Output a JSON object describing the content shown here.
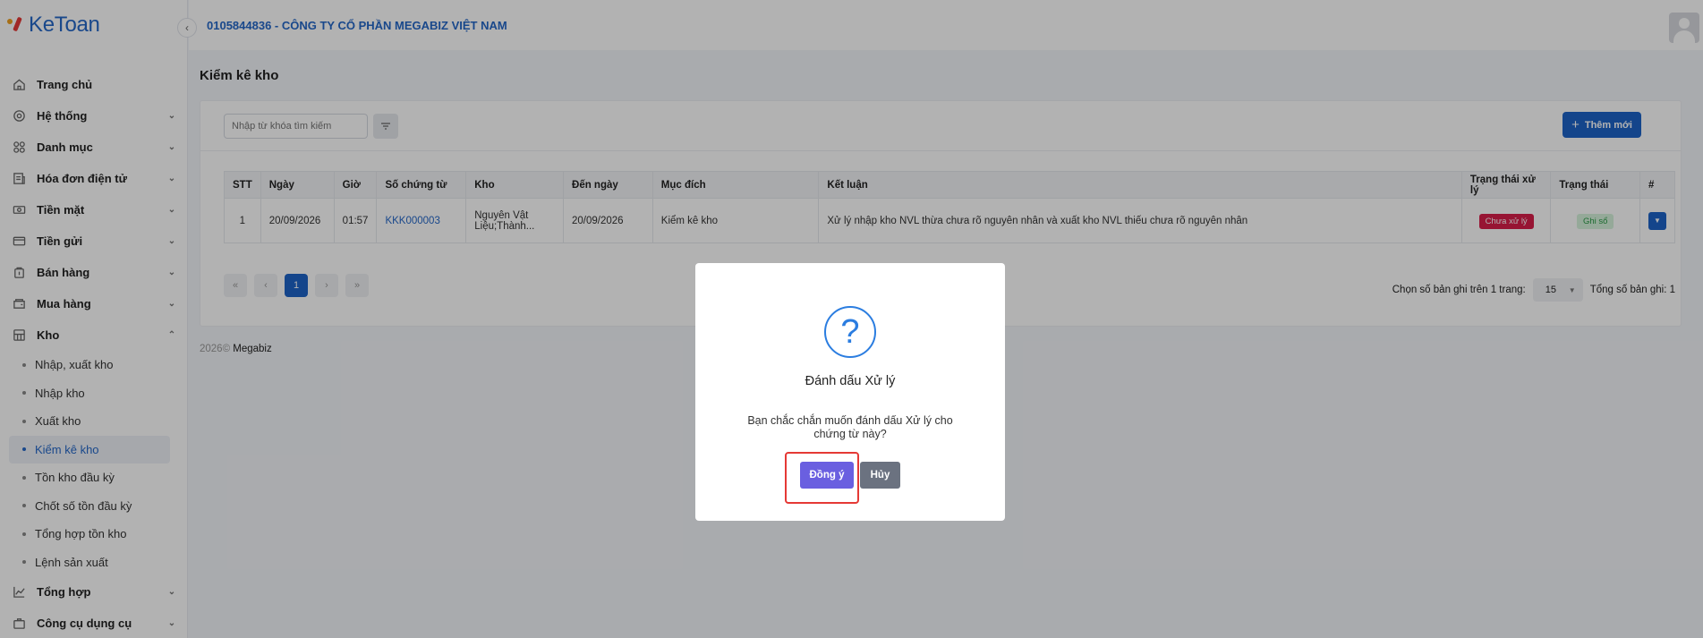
{
  "brand": {
    "logo_text": "KeToan"
  },
  "header": {
    "company": "0105844836 - CÔNG TY CỔ PHẦN MEGABIZ VIỆT NAM"
  },
  "sidebar": {
    "items": [
      {
        "label": "Trang chủ",
        "icon": "home-icon"
      },
      {
        "label": "Hệ thống",
        "icon": "settings-icon"
      },
      {
        "label": "Danh mục",
        "icon": "grid-icon"
      },
      {
        "label": "Hóa đơn điện tử",
        "icon": "invoice-icon"
      },
      {
        "label": "Tiền mặt",
        "icon": "cash-icon"
      },
      {
        "label": "Tiền gửi",
        "icon": "card-icon"
      },
      {
        "label": "Bán hàng",
        "icon": "sales-icon"
      },
      {
        "label": "Mua hàng",
        "icon": "purchase-icon"
      },
      {
        "label": "Kho",
        "icon": "warehouse-icon"
      }
    ],
    "kho_sub": [
      "Nhập, xuất kho",
      "Nhập kho",
      "Xuất kho",
      "Kiểm kê kho",
      "Tồn kho đầu kỳ",
      "Chốt số tồn đầu kỳ",
      "Tổng hợp tồn kho",
      "Lệnh sản xuất"
    ],
    "bottom_items": [
      {
        "label": "Tổng hợp",
        "icon": "chart-icon"
      },
      {
        "label": "Công cụ dụng cụ",
        "icon": "tools-icon"
      }
    ]
  },
  "page": {
    "title": "Kiểm kê kho"
  },
  "toolbar": {
    "search_placeholder": "Nhập từ khóa tìm kiếm",
    "add_label": "Thêm mới"
  },
  "table": {
    "headers": [
      "STT",
      "Ngày",
      "Giờ",
      "Số chứng từ",
      "Kho",
      "Đến ngày",
      "Mục đích",
      "Kết luận",
      "Trạng thái xử lý",
      "Trạng thái",
      "#"
    ],
    "rows": [
      {
        "stt": "1",
        "ngay": "20/09/2026",
        "gio": "01:57",
        "so_chung_tu": "KKK000003",
        "kho": "Nguyên Vật Liệu;Thành...",
        "den_ngay": "20/09/2026",
        "muc_dich": "Kiểm kê kho",
        "ket_luan": "Xử lý nhập kho NVL thừa chưa rõ nguyên nhân và xuất kho NVL thiếu chưa rõ nguyên nhân",
        "trang_thai_xu_ly": "Chưa xử lý",
        "trang_thai": "Ghi sổ"
      }
    ]
  },
  "pagination": {
    "current_page": "1",
    "page_size_label": "Chọn số bản ghi trên 1 trang:",
    "page_size": "15",
    "total_label": "Tổng số bản ghi:",
    "total": "1"
  },
  "footer": {
    "year": "2026©",
    "company": "Megabiz"
  },
  "dialog": {
    "title": "Đánh dấu Xử lý",
    "message": "Bạn chắc chắn muốn đánh dấu Xử lý cho chứng từ này?",
    "confirm_label": "Đồng ý",
    "cancel_label": "Hủy"
  },
  "colors": {
    "primary": "#1e63c8",
    "confirm": "#6a5fe0",
    "cancel": "#6b7280",
    "danger_badge": "#d81e4a",
    "highlight": "#e53935"
  }
}
